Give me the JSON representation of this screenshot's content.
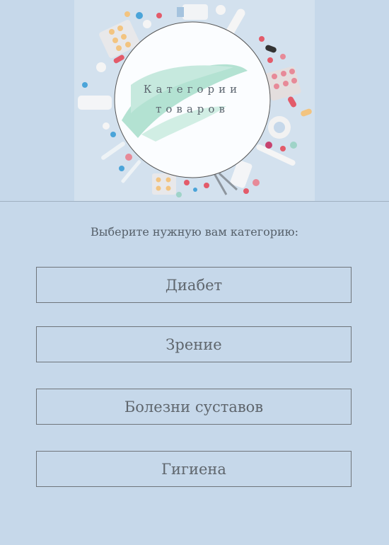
{
  "hero": {
    "title_line1": "Категории",
    "title_line2": "товаров"
  },
  "main": {
    "prompt": "Выберите нужную вам категорию:",
    "categories": [
      {
        "label": "Диабет"
      },
      {
        "label": "Зрение"
      },
      {
        "label": "Болезни суставов"
      },
      {
        "label": "Гигиена"
      }
    ]
  },
  "colors": {
    "background": "#c6d8ea",
    "border": "#6f757b",
    "text": "#5f666d",
    "watercolor": "#8fd3bd"
  }
}
